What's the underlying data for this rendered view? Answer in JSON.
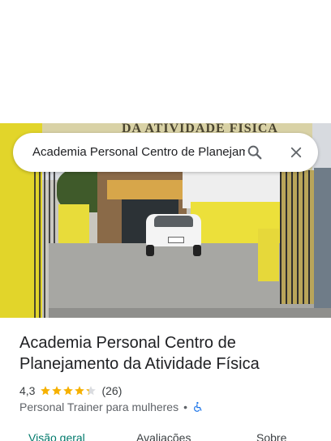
{
  "search": {
    "value": "Academia Personal Centro de Planejamento da Atividade Física",
    "search_icon": "search-icon",
    "close_icon": "close-icon"
  },
  "photo": {
    "banner_text": "DA ATIVIDADE FÍSICA"
  },
  "place": {
    "name": "Academia Personal Centro de Planejamento da Atividade Física",
    "rating": "4,3",
    "rating_value": 4.3,
    "stars_max": 5,
    "review_count": "(26)",
    "category": "Personal Trainer para mulheres",
    "separator": "•",
    "accessibility_icon": "wheelchair-icon"
  },
  "tabs": [
    {
      "label": "Visão geral",
      "active": true
    },
    {
      "label": "Avaliações",
      "active": false
    },
    {
      "label": "Sobre",
      "active": false
    }
  ],
  "colors": {
    "star": "#F6B100",
    "active_tab": "#00796b",
    "accessibility": "#1a73e8"
  }
}
